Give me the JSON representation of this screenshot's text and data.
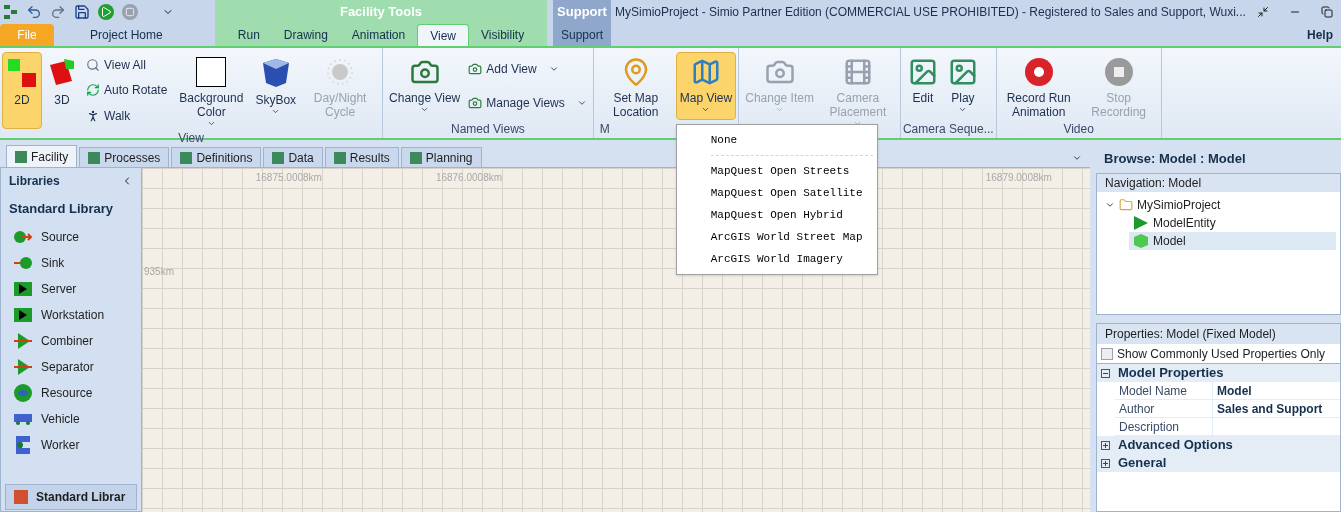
{
  "window": {
    "title": "MySimioProject - Simio Partner Edition (COMMERCIAL USE PROHIBITED) - Registered to Sales and Support, Wuxi..."
  },
  "context_groups": [
    {
      "label": "Facility Tools",
      "kind": "facility"
    },
    {
      "label": "Support",
      "kind": "support"
    }
  ],
  "ribbon_tabs": [
    {
      "label": "File",
      "kind": "file",
      "selected": false
    },
    {
      "label": "Project Home",
      "kind": "plain",
      "selected": false
    },
    {
      "label": "Run",
      "kind": "facility",
      "selected": false
    },
    {
      "label": "Drawing",
      "kind": "facility",
      "selected": false
    },
    {
      "label": "Animation",
      "kind": "facility",
      "selected": false
    },
    {
      "label": "View",
      "kind": "facility",
      "selected": true
    },
    {
      "label": "Visibility",
      "kind": "facility",
      "selected": false
    },
    {
      "label": "Support",
      "kind": "support",
      "selected": false
    }
  ],
  "help": "Help",
  "ribbon_groups": [
    {
      "label": "View",
      "items": [
        {
          "kind": "big",
          "label": "2D",
          "selected": true,
          "disabled": false,
          "dropdown": false
        },
        {
          "kind": "big",
          "label": "3D",
          "selected": false,
          "disabled": false,
          "dropdown": false
        },
        {
          "kind": "stack",
          "rows": [
            {
              "label": "View All",
              "dropdown": false
            },
            {
              "label": "Auto Rotate",
              "dropdown": false
            },
            {
              "label": "Walk",
              "dropdown": false
            }
          ]
        },
        {
          "kind": "big",
          "label": "Background Color",
          "dropdown": true,
          "disabled": false,
          "selected": false
        },
        {
          "kind": "big",
          "label": "SkyBox",
          "dropdown": true,
          "disabled": false,
          "selected": false
        },
        {
          "kind": "big",
          "label": "Day/Night Cycle",
          "disabled": true,
          "selected": false,
          "dropdown": false
        }
      ]
    },
    {
      "label": "Named Views",
      "items": [
        {
          "kind": "big",
          "label": "Change View",
          "dropdown": true,
          "disabled": false,
          "selected": false
        },
        {
          "kind": "stack",
          "rows": [
            {
              "label": "Add View",
              "dropdown": true
            },
            {
              "label": "Manage Views",
              "dropdown": true
            }
          ]
        }
      ]
    },
    {
      "label": "M",
      "items": [
        {
          "kind": "big",
          "label": "Set Map Location",
          "disabled": false,
          "selected": false,
          "dropdown": false
        },
        {
          "kind": "big",
          "label": "Map View",
          "dropdown": true,
          "disabled": false,
          "selected": true,
          "menu": [
            {
              "label": "None",
              "kind": "item"
            },
            {
              "kind": "separator"
            },
            {
              "label": "MapQuest Open Streets",
              "kind": "item"
            },
            {
              "label": "MapQuest Open Satellite",
              "kind": "item"
            },
            {
              "label": "MapQuest Open Hybrid",
              "kind": "item"
            },
            {
              "label": "ArcGIS World Street Map",
              "kind": "item"
            },
            {
              "label": "ArcGIS World Imagery",
              "kind": "item"
            }
          ]
        }
      ]
    },
    {
      "items": [
        {
          "kind": "big",
          "label": "Change Item",
          "dropdown": true,
          "disabled": true,
          "selected": false
        },
        {
          "kind": "big",
          "label": "Camera Placement",
          "dropdown": true,
          "disabled": true,
          "selected": false
        }
      ]
    },
    {
      "label": "Camera Seque...",
      "items": [
        {
          "kind": "big",
          "label": "Edit",
          "disabled": false,
          "selected": false,
          "dropdown": false
        },
        {
          "kind": "big",
          "label": "Play",
          "dropdown": true,
          "disabled": false,
          "selected": false
        }
      ]
    },
    {
      "label": "Video",
      "items": [
        {
          "kind": "big",
          "label": "Record Run Animation",
          "disabled": false,
          "selected": false,
          "dropdown": false
        },
        {
          "kind": "big",
          "label": "Stop Recording",
          "disabled": true,
          "selected": false,
          "dropdown": false
        }
      ]
    }
  ],
  "document_tabs": [
    {
      "label": "Facility",
      "selected": true
    },
    {
      "label": "Processes",
      "selected": false
    },
    {
      "label": "Definitions",
      "selected": false
    },
    {
      "label": "Data",
      "selected": false
    },
    {
      "label": "Results",
      "selected": false
    },
    {
      "label": "Planning",
      "selected": false
    }
  ],
  "libraries": {
    "title": "Libraries",
    "section": "Standard Library",
    "items": [
      "Source",
      "Sink",
      "Server",
      "Workstation",
      "Combiner",
      "Separator",
      "Resource",
      "Vehicle",
      "Worker"
    ],
    "bottom_tab": "Standard Librar"
  },
  "map": {
    "x_labels": [
      "16875.0008km",
      "16876.0008km",
      "16879.0008km"
    ],
    "y_labels": [
      "935km"
    ]
  },
  "browse": {
    "title": "Browse: Model : Model",
    "navigation_title": "Navigation: Model",
    "tree": [
      {
        "label": "MySimioProject",
        "kind": "folder",
        "expanded": true,
        "selected": false,
        "children": [
          {
            "label": "ModelEntity",
            "kind": "entity",
            "selected": false
          },
          {
            "label": "Model",
            "kind": "model",
            "selected": true
          }
        ]
      }
    ]
  },
  "properties": {
    "title": "Properties: Model (Fixed Model)",
    "filter": {
      "label": "Show Commonly Used Properties Only",
      "checked": false
    },
    "categories": [
      {
        "label": "Model Properties",
        "expanded": true,
        "rows": [
          {
            "name": "Model Name",
            "value": "Model"
          },
          {
            "name": "Author",
            "value": "Sales and Support"
          },
          {
            "name": "Description"
          }
        ]
      },
      {
        "label": "Advanced Options",
        "expanded": false
      },
      {
        "label": "General",
        "expanded": false
      }
    ]
  }
}
